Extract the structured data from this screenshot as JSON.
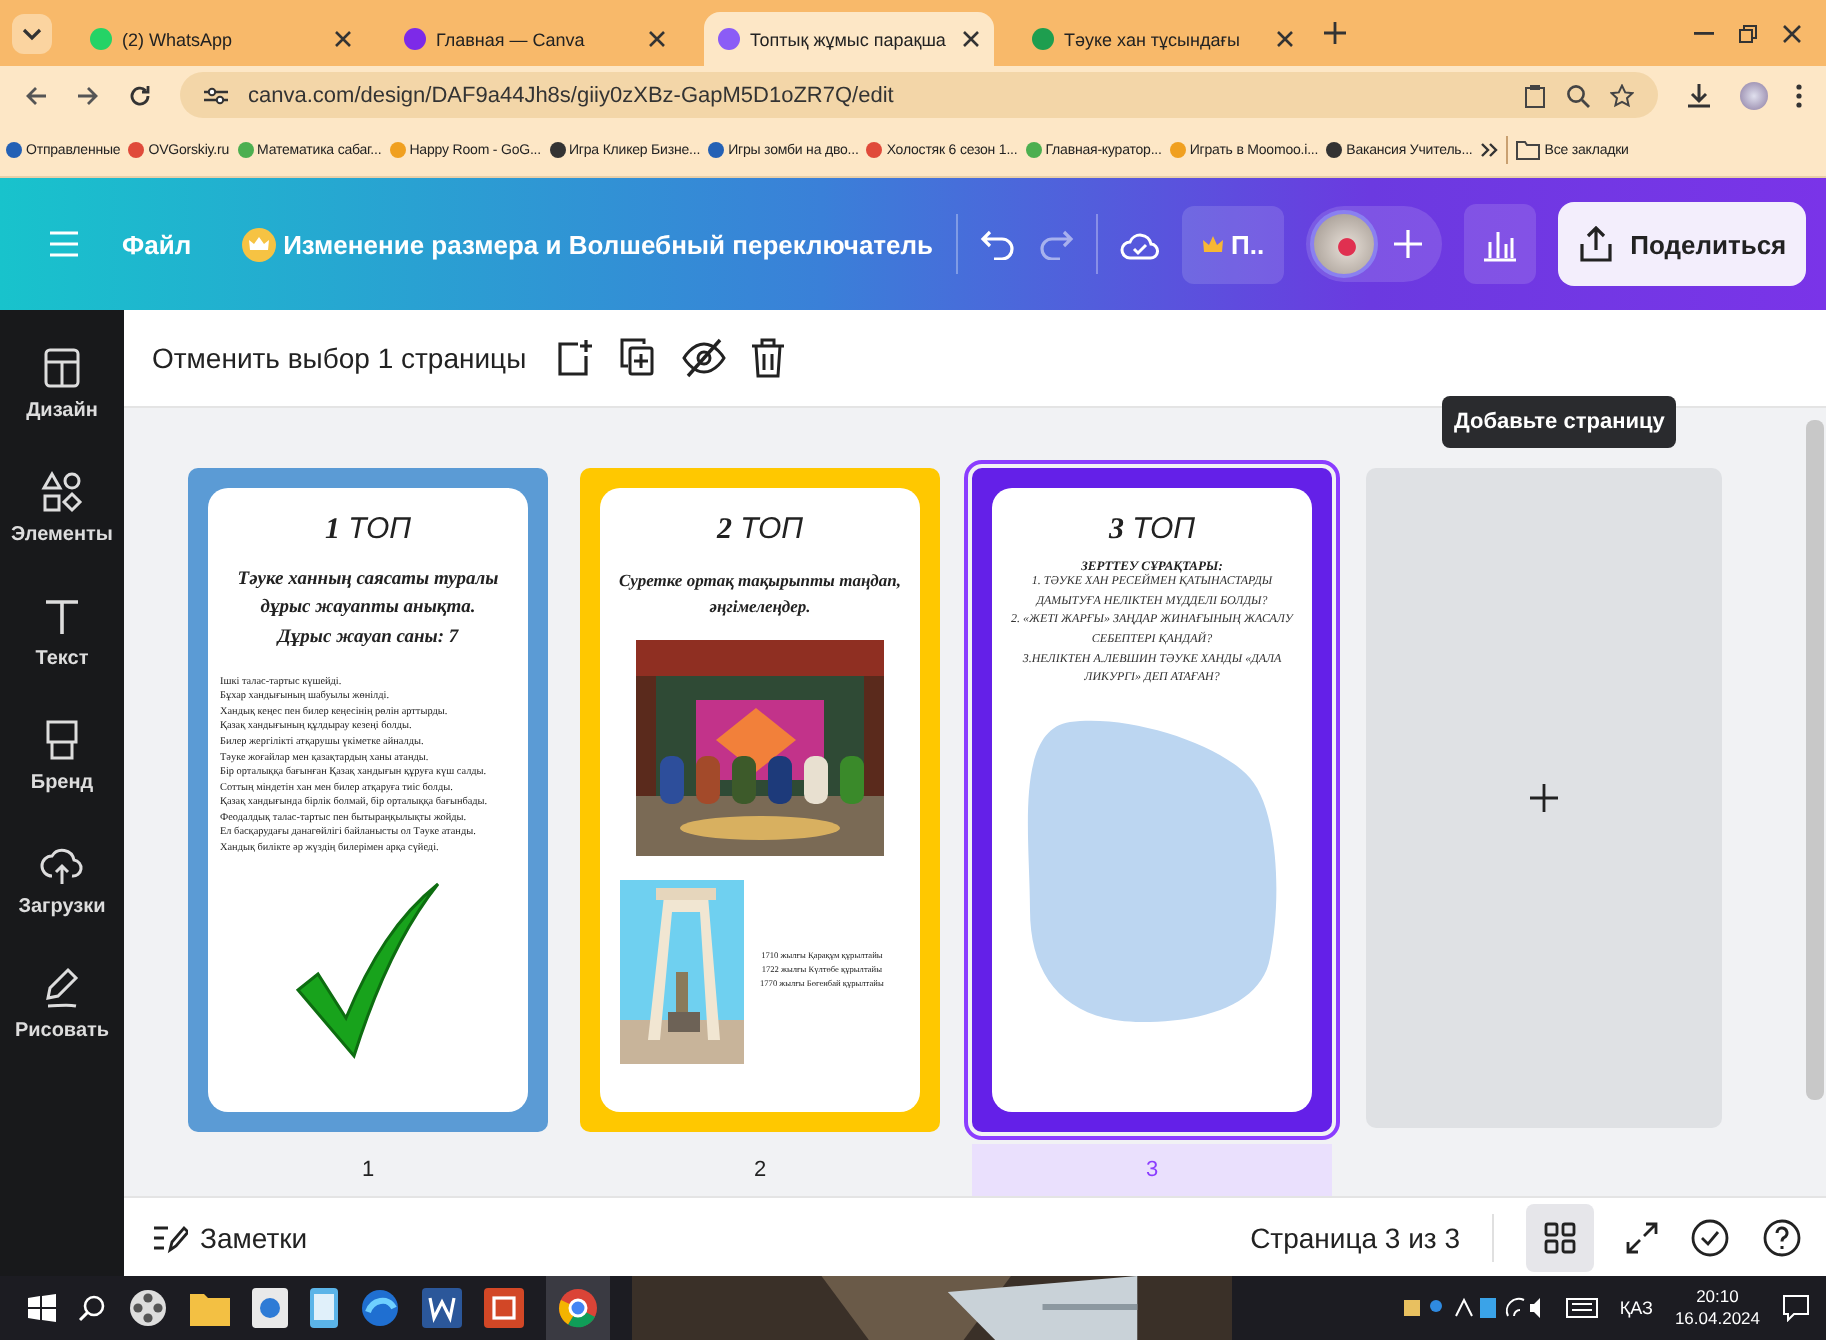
{
  "browser": {
    "tabs": [
      {
        "title": "(2) WhatsApp",
        "selected": false,
        "color": "#25d366"
      },
      {
        "title": "Главная — Canva",
        "selected": false,
        "color": "#7d2ae8"
      },
      {
        "title": "Топтық жұмыс парақша",
        "selected": true,
        "color": "#8b5cf6"
      },
      {
        "title": "Тәуке хан тұсындағы",
        "selected": false,
        "color": "#1e9e4f"
      }
    ],
    "url": "canva.com/design/DAF9a44Jh8s/giiy0zXBz-GapM5D1oZR7Q/edit",
    "bookmarks": [
      "Отправленные",
      "OVGorskiy.ru",
      "Математика сабаг...",
      "Happy Room - GoG...",
      "Игра Кликер Бизне...",
      "Игры зомби на дво...",
      "Холостяк 6 сезон 1...",
      "Главная-куратор...",
      "Играть в Moomoo.i...",
      "Вакансия Учитель..."
    ],
    "all_bookmarks": "Все закладки"
  },
  "header": {
    "file_menu": "Файл",
    "title": "Изменение размера и Волшебный переключатель",
    "plan": "П..",
    "share": "Поделиться"
  },
  "sidebar": [
    {
      "label": "Дизайн"
    },
    {
      "label": "Элементы"
    },
    {
      "label": "Текст"
    },
    {
      "label": "Бренд"
    },
    {
      "label": "Загрузки"
    },
    {
      "label": "Рисовать"
    }
  ],
  "toolbar": {
    "deselect": "Отменить выбор 1 страницы"
  },
  "tooltip": "Добавьте страницу",
  "pages": [
    {
      "kind": "list",
      "label": "1",
      "selected": false,
      "color": "#5b9bd5",
      "heading": "**1** ТОП",
      "subtitle": [
        "Тәуке ханның саясаты туралы",
        "дұрыс жауапты анықта.",
        "Дұрыс жауап саны: 7"
      ],
      "lines": [
        "Ішкі талас-тартыс күшейді.",
        "Бұхар хандығының шабуылы жөнілді.",
        "Хандық кеңес пен билер кеңесінің рөлін арттырды.",
        "Қазақ хандығының құлдырау кезеңі болды.",
        "Билер жергілікті атқарушы үкіметке айналды.",
        "Тәуке жоғайлар мен қазақтардың ханы атанды.",
        "Бір орталыққа бағынған Қазақ хандығын құруға күш салды.",
        "Соттың міндетін хан мен билер атқаруға тиіс болды.",
        "Қазақ хандығында бірлік болмай, бір орталыққа бағынбады.",
        "Феодалдық талас-тартыс пен бытыраңқылықты жойды.",
        "Ел басқарудағы данагөйлігі байланысты ол Тәуке атанды.",
        "Хандық билікте әр жүздің билерімен арқа сүйеді."
      ]
    },
    {
      "kind": "pictures",
      "label": "2",
      "selected": false,
      "color": "#ffc800",
      "heading": "**2** ТОП",
      "subtitle": [
        "Суретке ортақ тақырыпты таңдап,",
        "әңгімелеңдер."
      ],
      "lines": [
        "1710 жылғы Қарақұм құрылтайы",
        "1722 жылғы Күлтөбе құрылтайы",
        "1770 жылғы Бөгенбай құрылтайы"
      ]
    },
    {
      "kind": "questions",
      "label": "3",
      "selected": true,
      "color": "#6420e8",
      "heading": "**3** ТОП",
      "subtitle": [
        "ЗЕРТТЕУ СҰРАҚТАРЫ:"
      ],
      "lines": [
        "1. ТӘУКЕ ХАН РЕСЕЙМЕН ҚАТЫНАСТАРДЫ ДАМЫТУҒА НЕЛІКТЕН МҮДДЕЛІ БОЛДЫ?",
        "2. «ЖЕТІ ЖАРҒЫ» ЗАҢДАР ЖИНАҒЫНЫҢ ЖАСАЛУ СЕБЕПТЕРІ ҚАНДАЙ?",
        "3.НЕЛІКТЕН А.ЛЕВШИН ТӘУКЕ ХАНДЫ «ДАЛА ЛИКУРГІ» ДЕП АТАҒАН?"
      ]
    },
    {
      "kind": "add"
    }
  ],
  "footer": {
    "notes": "Заметки",
    "page_counter": "Страница 3 из 3"
  },
  "taskbar": {
    "language": "ҚАЗ",
    "time": "20:10",
    "date": "16.04.2024"
  }
}
